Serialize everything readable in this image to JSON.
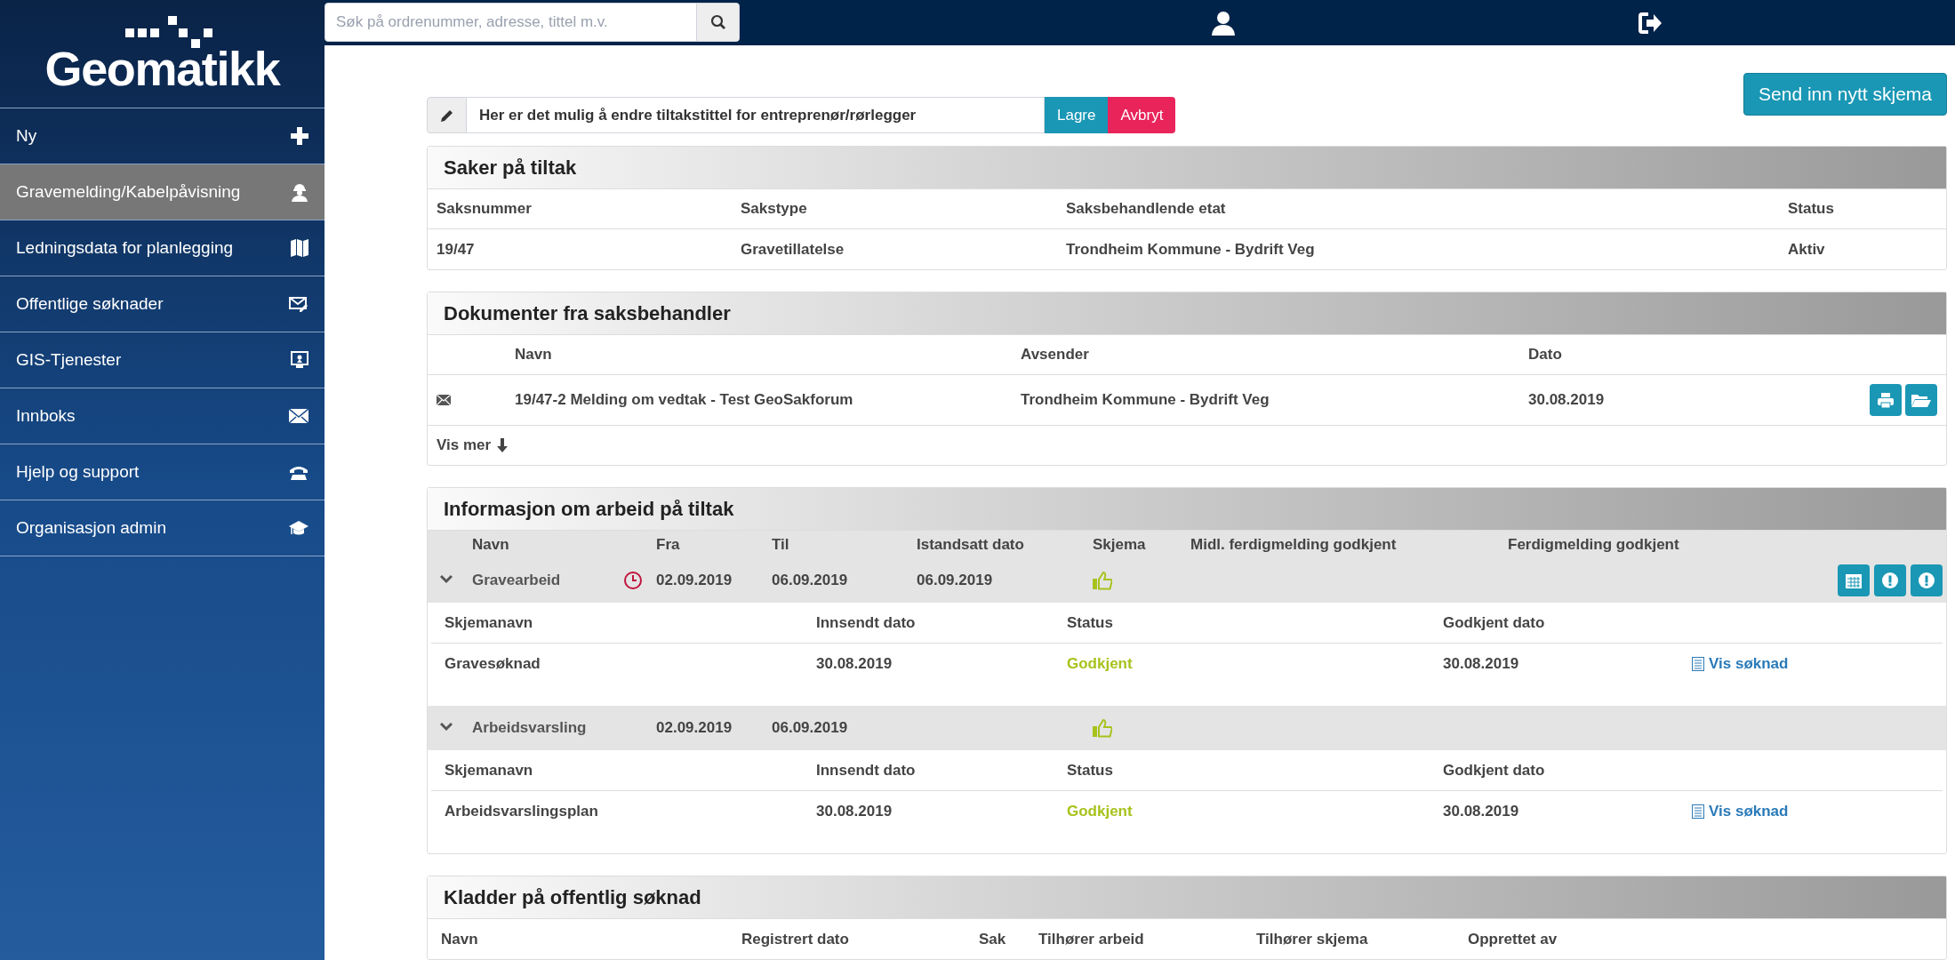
{
  "sidebar": {
    "logo": "Geomatikk",
    "items": [
      {
        "label": "Ny",
        "kind": "plus",
        "selected": false
      },
      {
        "label": "Gravemelding/Kabelpåvisning",
        "kind": "worker",
        "selected": true
      },
      {
        "label": "Ledningsdata for planlegging",
        "kind": "map",
        "selected": false
      },
      {
        "label": "Offentlige søknader",
        "kind": "mailedit",
        "selected": false
      },
      {
        "label": "GIS-Tjenester",
        "kind": "monitor",
        "selected": false
      },
      {
        "label": "Innboks",
        "kind": "mail",
        "selected": false
      },
      {
        "label": "Hjelp og support",
        "kind": "phone",
        "selected": false
      },
      {
        "label": "Organisasjon admin",
        "kind": "cap",
        "selected": false
      }
    ]
  },
  "topbar": {
    "search_placeholder": "Søk på ordrenummer, adresse, tittel m.v."
  },
  "title_edit": {
    "value": "Her er det mulig å endre tiltakstittel for entreprenør/rørlegger",
    "save": "Lagre",
    "cancel": "Avbryt"
  },
  "send_button": "Send inn nytt skjema",
  "saker": {
    "title": "Saker på tiltak",
    "columns": [
      "Saksnummer",
      "Sakstype",
      "Saksbehandlende etat",
      "Status"
    ],
    "rows": [
      [
        "19/47",
        "Gravetillatelse",
        "Trondheim Kommune - Bydrift Veg",
        "Aktiv"
      ]
    ]
  },
  "dokumenter": {
    "title": "Dokumenter fra saksbehandler",
    "columns": [
      "Navn",
      "Avsender",
      "Dato"
    ],
    "rows": [
      {
        "kind": "mail",
        "cells": [
          "19/47-2 Melding om vedtak - Test GeoSakforum",
          "Trondheim Kommune - Bydrift Veg",
          "30.08.2019"
        ]
      }
    ],
    "more": "Vis mer"
  },
  "informasjon": {
    "title": "Informasjon om arbeid på tiltak",
    "columns": [
      "Navn",
      "Fra",
      "Til",
      "Istandsatt dato",
      "Skjema",
      "Midl. ferdigmelding godkjent",
      "Ferdigmelding godkjent"
    ],
    "works": [
      {
        "name": "Gravearbeid",
        "expanded": true,
        "clock": true,
        "from": "02.09.2019",
        "to": "06.09.2019",
        "restored": "06.09.2019",
        "form_ok": true,
        "actions": [
          {
            "kind": "calendar"
          },
          {
            "kind": "alert"
          },
          {
            "kind": "alert"
          }
        ],
        "form_columns": [
          "Skjemanavn",
          "Innsendt dato",
          "Status",
          "Godkjent dato"
        ],
        "forms": [
          {
            "name": "Gravesøknad",
            "submitted": "30.08.2019",
            "status": "Godkjent",
            "approved": "30.08.2019",
            "link": "Vis søknad"
          }
        ]
      },
      {
        "name": "Arbeidsvarsling",
        "expanded": true,
        "clock": false,
        "from": "02.09.2019",
        "to": "06.09.2019",
        "form_ok": true,
        "form_columns": [
          "Skjemanavn",
          "Innsendt dato",
          "Status",
          "Godkjent dato"
        ],
        "forms": [
          {
            "name": "Arbeidsvarslingsplan",
            "submitted": "30.08.2019",
            "status": "Godkjent",
            "approved": "30.08.2019",
            "link": "Vis søknad"
          }
        ]
      }
    ]
  },
  "kladder": {
    "title": "Kladder på offentlig søknad",
    "columns": [
      "Navn",
      "Registrert dato",
      "Sak",
      "Tilhører arbeid",
      "Tilhører skjema",
      "Opprettet av"
    ]
  }
}
